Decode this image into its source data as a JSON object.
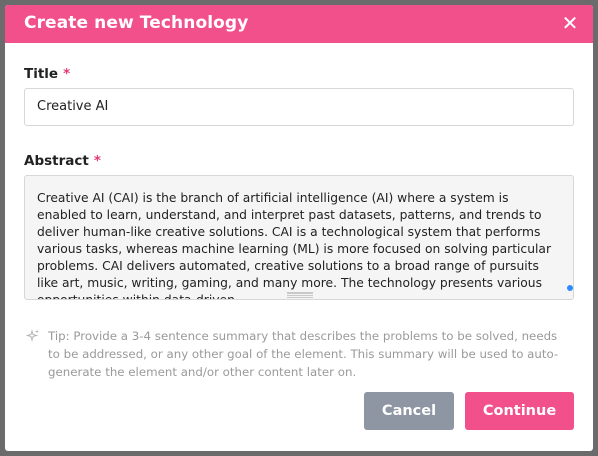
{
  "dialog": {
    "title": "Create new Technology",
    "close_icon": "close-icon"
  },
  "fields": {
    "title": {
      "label": "Title",
      "required_mark": "*",
      "value": "Creative AI"
    },
    "abstract": {
      "label": "Abstract",
      "required_mark": "*",
      "value": "Creative AI (CAI) is the branch of artificial intelligence (AI) where a system is enabled to learn, understand, and interpret past datasets, patterns, and trends to deliver human-like creative solutions. CAI is a technological system that performs various tasks, whereas machine learning (ML) is more focused on solving particular problems. CAI delivers automated, creative solutions to a broad range of pursuits like art, music, writing, gaming, and many more. The technology presents various opportunities within data-driven"
    }
  },
  "tip": {
    "icon": "sparkle-icon",
    "text": "Tip: Provide a 3-4 sentence summary that describes the problems to be solved, needs to be addressed, or any other goal of the element. This summary will be used to auto-generate the element and/or other content later on."
  },
  "buttons": {
    "cancel": "Cancel",
    "continue": "Continue"
  },
  "colors": {
    "accent": "#f2508b",
    "cancel": "#8e96a3",
    "scroll_indicator": "#2d8cff"
  }
}
